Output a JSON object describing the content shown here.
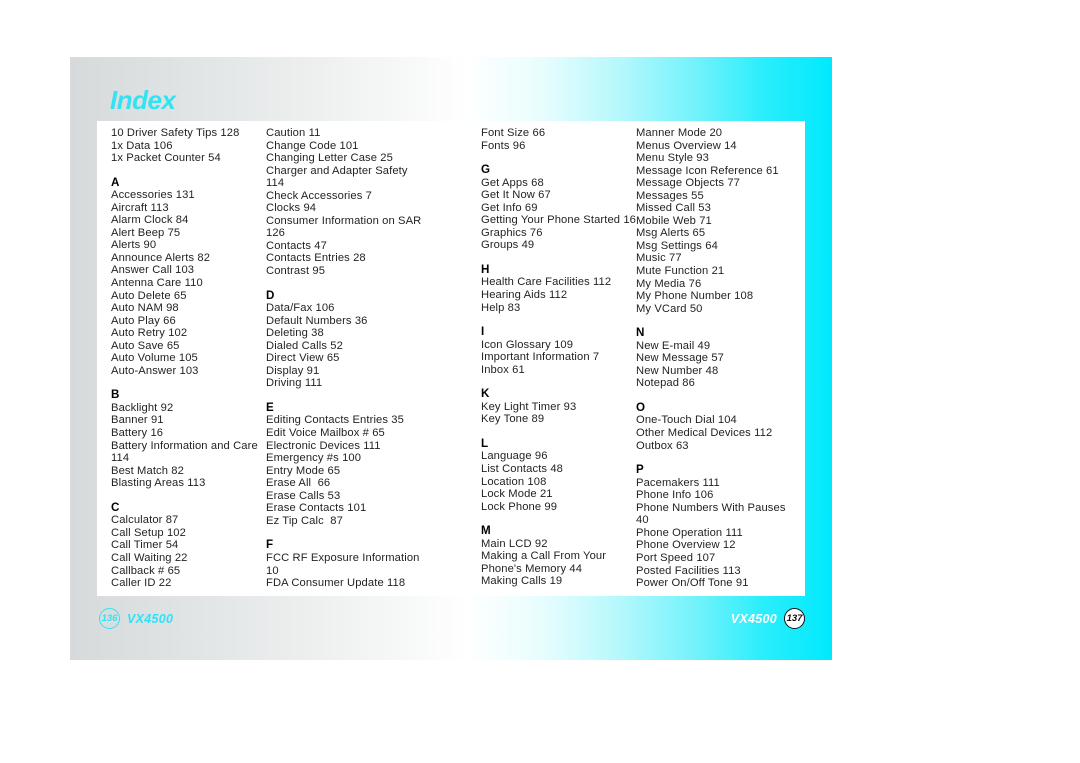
{
  "title": "Index",
  "colors": {
    "accent_cyan": "#00e9fd",
    "title_cyan": "#33e3f2",
    "text": "#231f20",
    "panel": "#ffffff"
  },
  "columns": [
    {
      "id": "column-1",
      "blocks": [
        {
          "letter": "",
          "entries": [
            "10 Driver Safety Tips 128",
            "1x Data 106",
            "1x Packet Counter 54"
          ]
        },
        {
          "letter": "A",
          "entries": [
            "Accessories 131",
            "Aircraft 113",
            "Alarm Clock 84",
            "Alert Beep 75",
            "Alerts 90",
            "Announce Alerts 82",
            "Answer Call 103",
            "Antenna Care 110",
            "Auto Delete 65",
            "Auto NAM 98",
            "Auto Play 66",
            "Auto Retry 102",
            "Auto Save 65",
            "Auto Volume 105",
            "Auto-Answer 103"
          ]
        },
        {
          "letter": "B",
          "entries": [
            "Backlight 92",
            "Banner 91",
            "Battery 16",
            "Battery Information and Care",
            "114",
            "Best Match 82",
            "Blasting Areas 113"
          ]
        },
        {
          "letter": "C",
          "entries": [
            "Calculator 87",
            "Call Setup 102",
            "Call Timer 54",
            "Call Waiting 22",
            "Callback # 65",
            "Caller ID 22"
          ]
        }
      ]
    },
    {
      "id": "column-2",
      "blocks": [
        {
          "letter": "",
          "entries": [
            "Caution 11",
            "Change Code 101",
            "Changing Letter Case 25",
            "Charger and Adapter Safety",
            "114",
            "Check Accessories 7",
            "Clocks 94",
            "Consumer Information on SAR",
            "126",
            "Contacts 47",
            "Contacts Entries 28",
            "Contrast 95"
          ]
        },
        {
          "letter": "D",
          "entries": [
            "Data/Fax 106",
            "Default Numbers 36",
            "Deleting 38",
            "Dialed Calls 52",
            "Direct View 65",
            "Display 91",
            "Driving 111"
          ]
        },
        {
          "letter": "E",
          "entries": [
            "Editing Contacts Entries 35",
            "Edit Voice Mailbox # 65",
            "Electronic Devices 111",
            "Emergency #s 100",
            "Entry Mode 65",
            "Erase All  66",
            "Erase Calls 53",
            "Erase Contacts 101",
            "Ez Tip Calc  87"
          ]
        },
        {
          "letter": "F",
          "entries": [
            "FCC RF Exposure Information",
            "10",
            "FDA Consumer Update 118"
          ]
        }
      ]
    },
    {
      "id": "column-3",
      "blocks": [
        {
          "letter": "",
          "entries": [
            "Font Size 66",
            "Fonts 96"
          ]
        },
        {
          "letter": "G",
          "entries": [
            "Get Apps 68",
            "Get It Now 67",
            "Get Info 69",
            "Getting Your Phone Started 16",
            "Graphics 76",
            "Groups 49"
          ]
        },
        {
          "letter": "H",
          "entries": [
            "Health Care Facilities 112",
            "Hearing Aids 112",
            "Help 83"
          ]
        },
        {
          "letter": "I",
          "entries": [
            "Icon Glossary 109",
            "Important Information 7",
            "Inbox 61"
          ]
        },
        {
          "letter": "K",
          "entries": [
            "Key Light Timer 93",
            "Key Tone 89"
          ]
        },
        {
          "letter": "L",
          "entries": [
            "Language 96",
            "List Contacts 48",
            "Location 108",
            "Lock Mode 21",
            "Lock Phone 99"
          ]
        },
        {
          "letter": "M",
          "entries": [
            "Main LCD 92",
            "Making a Call From Your",
            "Phone's Memory 44",
            "Making Calls 19"
          ]
        }
      ]
    },
    {
      "id": "column-4",
      "blocks": [
        {
          "letter": "",
          "entries": [
            "Manner Mode 20",
            "Menus Overview 14",
            "Menu Style 93",
            "Message Icon Reference 61",
            "Message Objects 77",
            "Messages 55",
            "Missed Call 53",
            "Mobile Web 71",
            "Msg Alerts 65",
            "Msg Settings 64",
            "Music 77",
            "Mute Function 21",
            "My Media 76",
            "My Phone Number 108",
            "My VCard 50"
          ]
        },
        {
          "letter": "N",
          "entries": [
            "New E-mail 49",
            "New Message 57",
            "New Number 48",
            "Notepad 86"
          ]
        },
        {
          "letter": "O",
          "entries": [
            "One-Touch Dial 104",
            "Other Medical Devices 112",
            "Outbox 63"
          ]
        },
        {
          "letter": "P",
          "entries": [
            "Pacemakers 111",
            "Phone Info 106",
            "Phone Numbers With Pauses",
            "40",
            "Phone Operation 111",
            "Phone Overview 12",
            "Port Speed 107",
            "Posted Facilities 113",
            "Power On/Off Tone 91"
          ]
        }
      ]
    }
  ],
  "footer_left": {
    "page_number": "136",
    "model": "VX4500"
  },
  "footer_right": {
    "page_number": "137",
    "model": "VX4500"
  }
}
